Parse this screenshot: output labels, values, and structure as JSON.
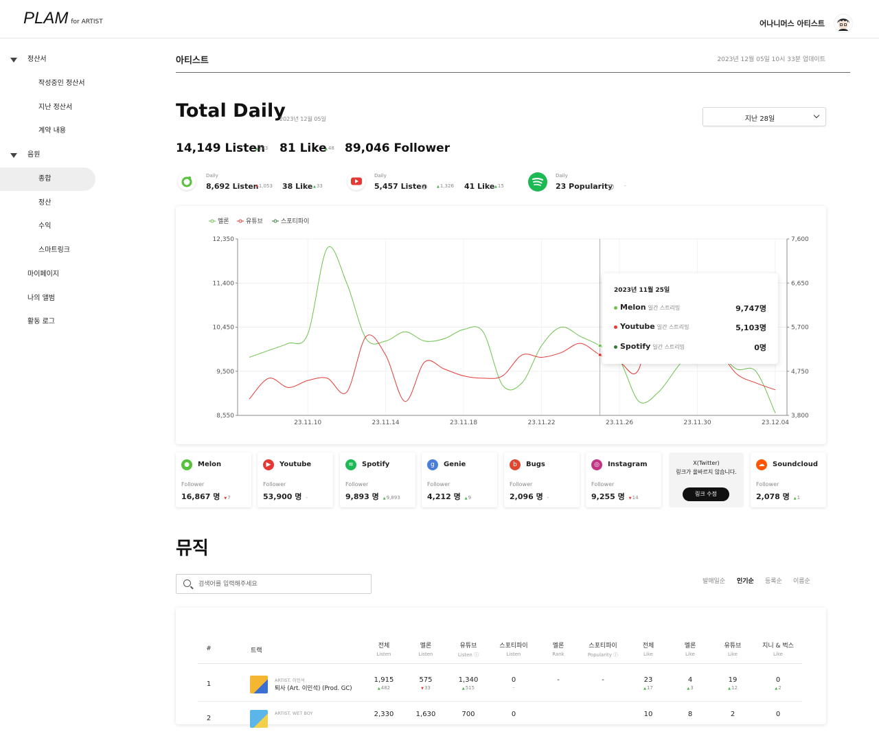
{
  "header": {
    "logo_main": "PLAM",
    "logo_sub": "for ARTIST",
    "user_name": "어나니머스 아티스트"
  },
  "sidebar": {
    "groups": [
      {
        "label": "정산서",
        "items": [
          "작성중인 정산서",
          "지난 정산서",
          "계약 내용"
        ]
      },
      {
        "label": "음원",
        "items": [
          "종합",
          "정산",
          "수익",
          "스마트링크"
        ]
      }
    ],
    "selected": "종합",
    "links": [
      "마이페이지",
      "나의 앨범",
      "활동 로그"
    ]
  },
  "page": {
    "breadcrumb": "아티스트",
    "updated": "2023년 12월 05일 10시 33분 업데이트"
  },
  "summary": {
    "title": "Total Daily",
    "date": "2023년 12월 05일",
    "period_select": "지난 28일",
    "listen": "14,149 Listen",
    "listen_delta": "273",
    "like": "81 Like",
    "like_delta": "48",
    "follower": "89,046 Follower",
    "follower_delta": "-"
  },
  "daily": [
    {
      "platform": "melon",
      "label": "Daily",
      "v1": "8,692 Listen",
      "d1": "1,053",
      "d1_dir": "down",
      "v2": "38 Like",
      "d2": "33",
      "d2_dir": "up"
    },
    {
      "platform": "youtube",
      "label": "Daily",
      "v1": "5,457 Listen",
      "d1": "1,326",
      "d1_dir": "up",
      "v2": "41 Like",
      "d2": "15",
      "d2_dir": "up"
    },
    {
      "platform": "spotify",
      "label": "Daily",
      "v1": "23 Popularity",
      "d1": "-"
    }
  ],
  "chart_data": {
    "type": "line",
    "legend": [
      "멜론",
      "유튜브",
      "스포티파이"
    ],
    "colors": {
      "melon": "#6cc24a",
      "youtube": "#e53935",
      "spotify": "#2e7d32"
    },
    "x_ticks": [
      "23.11.10",
      "23.11.14",
      "23.11.18",
      "23.11.22",
      "23.11.26",
      "23.11.30",
      "23.12.04"
    ],
    "y_left_ticks": [
      "12,350",
      "11,400",
      "10,450",
      "9,500",
      "8,550"
    ],
    "y_right_ticks": [
      "7,600",
      "6,650",
      "5,700",
      "4,750",
      "3,800"
    ],
    "ylim_left": [
      8550,
      12350
    ],
    "ylim_right": [
      3800,
      7600
    ],
    "dates": [
      "11.07",
      "11.08",
      "11.09",
      "11.10",
      "11.11",
      "11.12",
      "11.13",
      "11.14",
      "11.15",
      "11.16",
      "11.17",
      "11.18",
      "11.19",
      "11.20",
      "11.21",
      "11.22",
      "11.23",
      "11.24",
      "11.25",
      "11.26",
      "11.27",
      "11.28",
      "11.29",
      "11.30",
      "12.01",
      "12.02",
      "12.03",
      "12.04"
    ],
    "series": [
      {
        "name": "멜론",
        "axis": "left",
        "values": [
          9800,
          9950,
          10100,
          10300,
          12150,
          11400,
          10200,
          10150,
          10350,
          10150,
          10200,
          10400,
          10350,
          9200,
          9250,
          10050,
          10450,
          10250,
          10050,
          9747,
          8850,
          9050,
          9600,
          10100,
          9950,
          9550,
          9500,
          8600
        ]
      },
      {
        "name": "유튜브",
        "axis": "right",
        "values": [
          4150,
          4600,
          4400,
          4550,
          4600,
          4300,
          5500,
          5100,
          4100,
          4950,
          4800,
          4650,
          4600,
          4650,
          5100,
          5050,
          5150,
          5350,
          5103,
          4950,
          4800,
          6700,
          5400,
          5600,
          5250,
          4700,
          4500,
          4350
        ]
      },
      {
        "name": "스포티파이",
        "axis": "right",
        "values": []
      }
    ],
    "tooltip": {
      "date": "2023년 11월 25일",
      "rows": [
        {
          "name": "Melon",
          "sub": "일간 스트리밍",
          "value": "9,747명",
          "color": "#6cc24a"
        },
        {
          "name": "Youtube",
          "sub": "일간 스트리밍",
          "value": "5,103명",
          "color": "#e53935"
        },
        {
          "name": "Spotify",
          "sub": "일간 스트리밍",
          "value": "0명",
          "color": "#2e7d32"
        }
      ]
    }
  },
  "platforms": [
    {
      "name": "Melon",
      "label": "Follower",
      "count": "16,867 명",
      "delta": "7",
      "dir": "down",
      "color": "#55c23a",
      "icon": "melon-icon"
    },
    {
      "name": "Youtube",
      "label": "Follower",
      "count": "53,900 명",
      "delta": "-",
      "dir": "none",
      "color": "#e53935",
      "icon": "youtube-icon"
    },
    {
      "name": "Spotify",
      "label": "Follower",
      "count": "9,893 명",
      "delta": "9,893",
      "dir": "up",
      "color": "#1db954",
      "icon": "spotify-icon"
    },
    {
      "name": "Genie",
      "label": "Follower",
      "count": "4,212 명",
      "delta": "9",
      "dir": "up",
      "color": "#4a7ed8",
      "icon": "genie-icon"
    },
    {
      "name": "Bugs",
      "label": "Follower",
      "count": "2,096 명",
      "delta": "-",
      "dir": "none",
      "color": "#e0462f",
      "icon": "bugs-icon"
    },
    {
      "name": "Instagram",
      "label": "Follower",
      "count": "9,255 명",
      "delta": "14",
      "dir": "down",
      "color": "#c13584",
      "icon": "instagram-icon"
    },
    {
      "name": "Soundcloud",
      "label": "Follower",
      "count": "2,078 명",
      "delta": "1",
      "dir": "up",
      "color": "#ff5500",
      "icon": "soundcloud-icon"
    }
  ],
  "twitter": {
    "name": "X(Twitter)",
    "message": "링크가 올바르지 않습니다.",
    "button": "링크 수정"
  },
  "music": {
    "title": "뮤직",
    "search_placeholder": "검색어를 입력해주세요",
    "sorts": [
      "발매일순",
      "인기순",
      "등록순",
      "이름순"
    ],
    "active_sort": "인기순",
    "columns": [
      {
        "h": "#",
        "s": ""
      },
      {
        "h": "트랙",
        "s": ""
      },
      {
        "h": "전체",
        "s": "Listen"
      },
      {
        "h": "멜론",
        "s": "Listen"
      },
      {
        "h": "유튜브",
        "s": "Listen"
      },
      {
        "h": "스포티파이",
        "s": "Listen"
      },
      {
        "h": "멜론",
        "s": "Rank"
      },
      {
        "h": "스포티파이",
        "s": "Popularity"
      },
      {
        "h": "전체",
        "s": "Like"
      },
      {
        "h": "멜론",
        "s": "Like"
      },
      {
        "h": "유튜브",
        "s": "Like"
      },
      {
        "h": "지니 & 벅스",
        "s": "Like"
      }
    ],
    "rows": [
      {
        "num": "1",
        "artist": "ARTIST. 이민석",
        "title": "퇴사 (Art. 이민석) (Prod. GC)",
        "cells": [
          {
            "v": "1,915",
            "d": "482",
            "dir": "up"
          },
          {
            "v": "575",
            "d": "33",
            "dir": "down"
          },
          {
            "v": "1,340",
            "d": "515",
            "dir": "up"
          },
          {
            "v": "0",
            "d": "-",
            "dir": "none"
          },
          {
            "v": "-",
            "d": "",
            "dir": "none"
          },
          {
            "v": "-",
            "d": "",
            "dir": "none"
          },
          {
            "v": "23",
            "d": "17",
            "dir": "up"
          },
          {
            "v": "4",
            "d": "3",
            "dir": "up"
          },
          {
            "v": "19",
            "d": "12",
            "dir": "up"
          },
          {
            "v": "0",
            "d": "2",
            "dir": "up"
          }
        ]
      },
      {
        "num": "2",
        "artist": "ARTIST. WET BOY",
        "title": "",
        "cells": [
          {
            "v": "2,330",
            "d": "",
            "dir": "none"
          },
          {
            "v": "1,630",
            "d": "",
            "dir": "none"
          },
          {
            "v": "700",
            "d": "",
            "dir": "none"
          },
          {
            "v": "0",
            "d": "",
            "dir": "none"
          },
          {
            "v": "",
            "d": "",
            "dir": "none"
          },
          {
            "v": "",
            "d": "",
            "dir": "none"
          },
          {
            "v": "10",
            "d": "",
            "dir": "none"
          },
          {
            "v": "8",
            "d": "",
            "dir": "none"
          },
          {
            "v": "2",
            "d": "",
            "dir": "none"
          },
          {
            "v": "0",
            "d": "",
            "dir": "none"
          }
        ]
      }
    ]
  }
}
